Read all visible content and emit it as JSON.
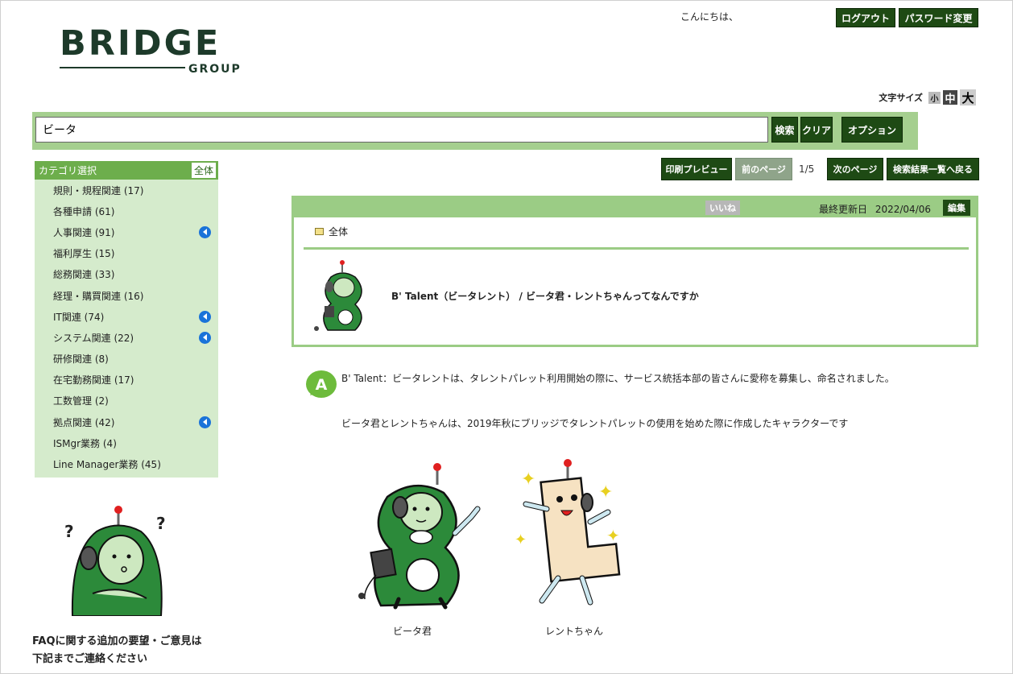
{
  "header": {
    "logo_text": "BRIDGE",
    "logo_sub": "GROUP",
    "greeting": "こんにちは、",
    "logout_label": "ログアウト",
    "password_label": "パスワード変更",
    "font_size_label": "文字サイズ",
    "font_sizes": [
      "小",
      "中",
      "大"
    ]
  },
  "search": {
    "value": "ビータ",
    "search_label": "検索",
    "clear_label": "クリア",
    "option_label": "オプション"
  },
  "sidebar": {
    "title": "カテゴリ選択",
    "all_label": "全体",
    "items": [
      {
        "label": "規則・規程関連 (17)",
        "expandable": false
      },
      {
        "label": "各種申請 (61)",
        "expandable": false
      },
      {
        "label": "人事関連 (91)",
        "expandable": true
      },
      {
        "label": "福利厚生 (15)",
        "expandable": false
      },
      {
        "label": "総務関連 (33)",
        "expandable": false
      },
      {
        "label": "経理・購買関連 (16)",
        "expandable": false
      },
      {
        "label": "IT関連 (74)",
        "expandable": true
      },
      {
        "label": "システム関連 (22)",
        "expandable": true
      },
      {
        "label": "研修関連 (8)",
        "expandable": false
      },
      {
        "label": "在宅勤務関連 (17)",
        "expandable": false
      },
      {
        "label": "工数管理 (2)",
        "expandable": false
      },
      {
        "label": "拠点関連 (42)",
        "expandable": true
      },
      {
        "label": "ISMgr業務 (4)",
        "expandable": false
      },
      {
        "label": "Line Manager業務 (45)",
        "expandable": false
      }
    ],
    "note_line1": "FAQに関する追加の要望・ご意見は",
    "note_line2": "下記までご連絡ください"
  },
  "toolbar": {
    "print_preview": "印刷プレビュー",
    "prev_page": "前のページ",
    "pager": "1/5",
    "next_page": "次のページ",
    "back_to_results": "検索結果一覧へ戻る"
  },
  "article": {
    "like_label": "いいね",
    "updated_label": "最終更新日",
    "updated_date": "2022/04/06",
    "edit_label": "編集",
    "category": "全体",
    "question": "B' Talent（ビータレント） / ビータ君・レントちゃんってなんですか",
    "answer_line1": "B' Talent：ビータレントは、タレントパレット利用開始の際に、サービス統括本部の皆さんに愛称を募集し、命名されました。",
    "answer_line2": "ビータ君とレントちゃんは、2019年秋にブリッジでタレントパレットの使用を始めた際に作成したキャラクターです",
    "char1_name": "ビータ君",
    "char2_name": "レントちゃん",
    "answer_badge": "A"
  },
  "colors": {
    "dark_green": "#1e4a14",
    "light_green": "#9bcc85",
    "sidebar_bg": "#d5ebcc",
    "sidebar_head": "#6dae4c",
    "expand_blue": "#1a73d9",
    "mascot_green": "#2c8a3a"
  }
}
